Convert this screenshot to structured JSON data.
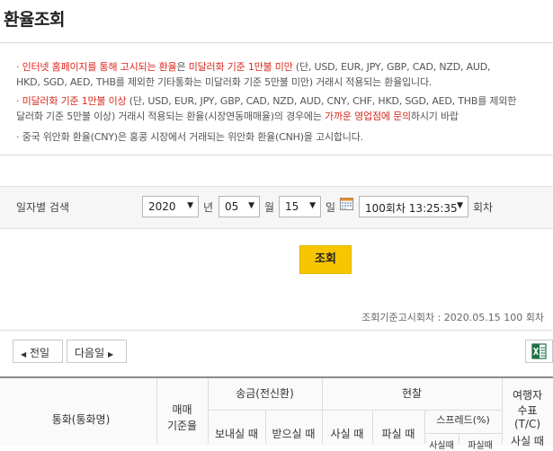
{
  "page": {
    "title": "환율조회"
  },
  "notice": {
    "line1": {
      "a": "인터넷 홈페이지를 통해 고시되는 환율",
      "b": "은 ",
      "c": "미달러화 기준 1만불 미만",
      "d": " (단, USD, EUR, JPY, GBP, CAD, NZD, AUD,"
    },
    "line2": "HKD, SGD, AED, THB를 제외한 기타통화는 미달러화 기준 5만불 미만) 거래시 적용되는 환율입니다.",
    "line3": {
      "a": "미달러화 기준 1만불 이상",
      "b": " (단, USD, EUR, JPY, GBP, CAD, NZD, AUD, CNY, CHF, HKD, SGD, AED, THB를 제외한"
    },
    "line4": {
      "a": "달러화 기준 5만불 이상) 거래시 적용되는 환율(시장연동매매율)의 경우에는 ",
      "b": "가까운 영업점에 문의",
      "c": "하시기 바랍"
    },
    "line5": "중국 위안화 환율(CNY)은 홍콩 시장에서 거래되는 위안화 환율(CNH)을 고시합니다."
  },
  "search": {
    "label": "일자별 검색",
    "year": "2020",
    "year_unit": "년",
    "month": "05",
    "month_unit": "월",
    "day": "15",
    "day_unit": "일",
    "round": "100회차 13:25:35",
    "round_unit": "회차",
    "button": "조회"
  },
  "reference": "조회기준고시회차 : 2020.05.15 100 회차",
  "pager": {
    "prev": "전일",
    "next": "다음일"
  },
  "table": {
    "currency": "통화(통화명)",
    "base_rate_1": "매매",
    "base_rate_2": "기준율",
    "remit": "송금(전신환)",
    "remit_send": "보내실 때",
    "remit_receive": "받으실 때",
    "cash": "현찰",
    "cash_buy": "사실 때",
    "cash_sell": "파실 때",
    "spread": "스프레드(%)",
    "spread_buy": "사실때",
    "spread_sell": "파실때",
    "tc_1": "여행자",
    "tc_2": "수표",
    "tc_3": "(T/C)",
    "tc_4": "사실 때"
  }
}
